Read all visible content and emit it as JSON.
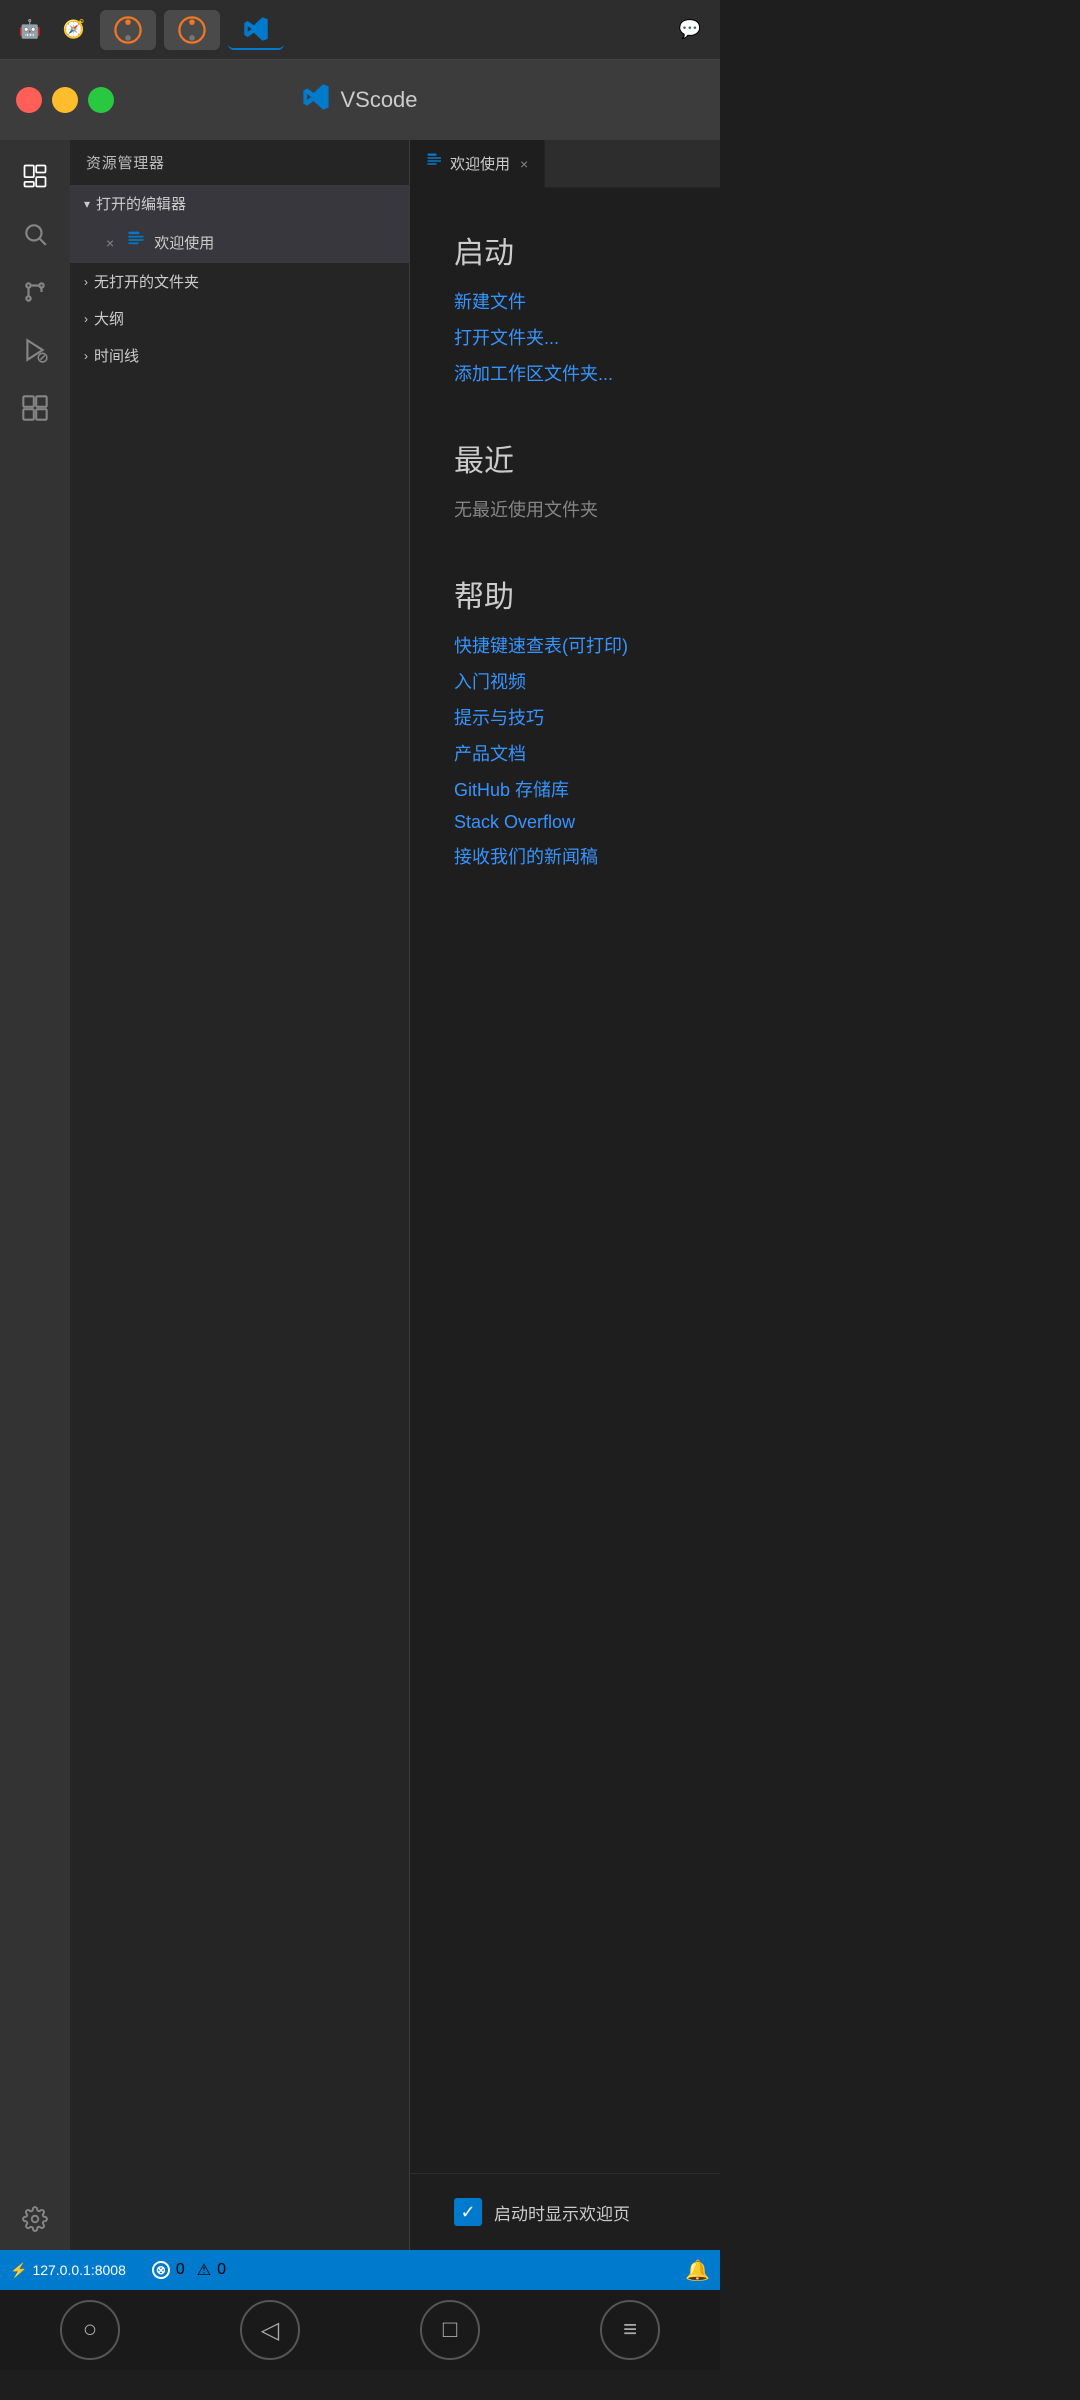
{
  "os_bar": {
    "tabs": [
      {
        "label": "Android",
        "icon": "🤖",
        "active": false
      },
      {
        "label": "Safari",
        "icon": "🧭",
        "active": false
      },
      {
        "label": "Jupyter",
        "icon": "J",
        "active": false
      },
      {
        "label": "Jupyter2",
        "icon": "J",
        "active": false
      },
      {
        "label": "VSCode",
        "icon": "VS",
        "active": true
      }
    ],
    "chat_icon": "💬"
  },
  "title_bar": {
    "title": "VScode",
    "icon_label": "VS"
  },
  "activity_bar": {
    "items": [
      {
        "name": "explorer",
        "icon": "📋",
        "active": true
      },
      {
        "name": "search",
        "icon": "🔍",
        "active": false
      },
      {
        "name": "git",
        "icon": "⎇",
        "active": false
      },
      {
        "name": "run-debug",
        "icon": "▷",
        "active": false
      },
      {
        "name": "extensions",
        "icon": "⊞",
        "active": false
      }
    ],
    "bottom": [
      {
        "name": "settings",
        "icon": "⚙"
      }
    ]
  },
  "sidebar": {
    "header": "资源管理器",
    "sections": [
      {
        "name": "open-editors",
        "label": "打开的编辑器",
        "expanded": true,
        "items": [
          {
            "label": "欢迎使用",
            "icon": "📄",
            "active": true,
            "has_close": true
          }
        ]
      },
      {
        "name": "no-folder",
        "label": "无打开的文件夹",
        "expanded": false,
        "items": []
      },
      {
        "name": "outline",
        "label": "大纲",
        "expanded": false,
        "items": []
      },
      {
        "name": "timeline",
        "label": "时间线",
        "expanded": false,
        "items": []
      }
    ]
  },
  "editor": {
    "tab_label": "欢迎使用",
    "tab_icon": "📄",
    "close_label": "×"
  },
  "welcome": {
    "start_section": {
      "title": "启动",
      "links": [
        {
          "label": "新建文件",
          "key": "new-file"
        },
        {
          "label": "打开文件夹...",
          "key": "open-folder"
        },
        {
          "label": "添加工作区文件夹...",
          "key": "add-workspace"
        }
      ]
    },
    "recent_section": {
      "title": "最近",
      "empty_label": "无最近使用文件夹"
    },
    "help_section": {
      "title": "帮助",
      "links": [
        {
          "label": "快捷键速查表(可打印)",
          "key": "keyboard-shortcut"
        },
        {
          "label": "入门视频",
          "key": "intro-videos"
        },
        {
          "label": "提示与技巧",
          "key": "tips-tricks"
        },
        {
          "label": "产品文档",
          "key": "product-docs"
        },
        {
          "label": "GitHub 存储库",
          "key": "github-repo"
        },
        {
          "label": "Stack Overflow",
          "key": "stack-overflow"
        },
        {
          "label": "接收我们的新闻稿",
          "key": "newsletter"
        }
      ]
    }
  },
  "checkbox": {
    "checked": true,
    "label": "启动时显示欢迎页"
  },
  "status_bar": {
    "port": "127.0.0.1:8008",
    "errors": "0",
    "warnings": "0",
    "remote_icon": "⚡"
  },
  "bottom_nav": {
    "back": "◁",
    "home": "○",
    "square": "□",
    "menu": "≡"
  }
}
